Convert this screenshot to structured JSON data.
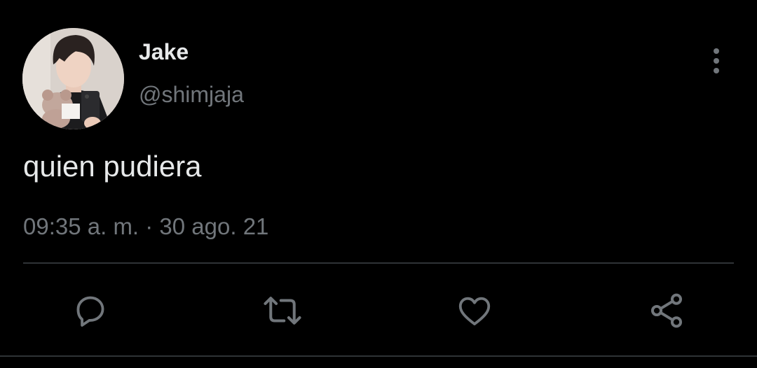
{
  "author": {
    "name": "Jake",
    "handle": "@shimjaja"
  },
  "tweet": {
    "text": "quien pudiera",
    "timestamp": "09:35 a. m. · 30 ago. 21"
  },
  "actions": [
    {
      "icon": "reply-icon"
    },
    {
      "icon": "retweet-icon"
    },
    {
      "icon": "like-icon"
    },
    {
      "icon": "share-icon"
    }
  ],
  "colors": {
    "background": "#000000",
    "primary_text": "#e7e9ea",
    "secondary_text": "#71767b",
    "divider": "#2f3336"
  }
}
